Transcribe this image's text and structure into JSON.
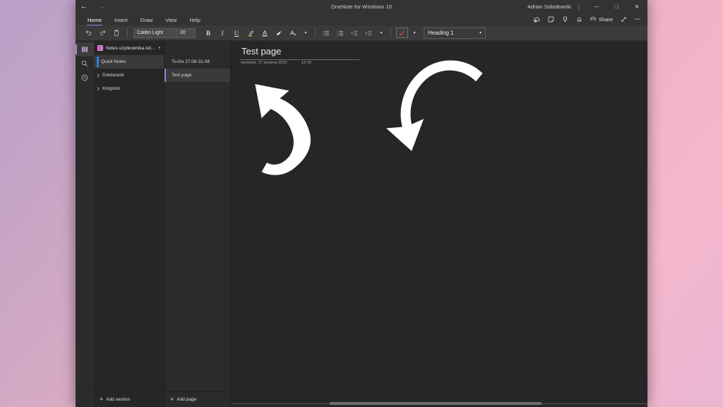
{
  "window": {
    "title": "OneNote for Windows 10",
    "account": "Adrian Sobolewski",
    "back_icon": "back-arrow-icon",
    "forward_icon": "forward-arrow-icon",
    "minimize": "─",
    "maximize": "□",
    "close": "✕",
    "separator": "|"
  },
  "ribbon": {
    "tabs": [
      {
        "label": "Home",
        "active": true
      },
      {
        "label": "Insert",
        "active": false
      },
      {
        "label": "Draw",
        "active": false
      },
      {
        "label": "View",
        "active": false
      },
      {
        "label": "Help",
        "active": false
      }
    ],
    "right_icons": [
      "sync-cloud-icon",
      "sticky-note-icon",
      "idea-lightbulb-icon",
      "notification-bell-icon"
    ],
    "share_label": "Share",
    "share_icon": "share-icon",
    "expand_icon": "expand-diagonal-icon",
    "more_icon": "more-options-icon"
  },
  "toolbar": {
    "undo_icon": "undo-icon",
    "redo_icon": "redo-icon",
    "clipboard_icon": "clipboard-paste-icon",
    "font_name": "Calibri Light",
    "font_size": "20",
    "bold_label": "B",
    "italic_label": "I",
    "underline_label": "U",
    "highlight_icon": "highlighter-icon",
    "font_color_icon": "font-color-icon",
    "format_painter_icon": "format-painter-icon",
    "clear_format_icon": "clear-formatting-icon",
    "more_format_icon": "chevron-down-icon",
    "bullets_icon": "bullet-list-icon",
    "numbering_icon": "numbered-list-icon",
    "decrease_indent_icon": "decrease-indent-icon",
    "increase_indent_icon": "increase-indent-icon",
    "indent_more_icon": "chevron-down-icon",
    "todo_tag_icon": "todo-checkbox-icon",
    "tag_more_icon": "chevron-down-icon",
    "style_value": "Heading 1",
    "style_chevron": "chevron-down-icon",
    "highlight_color": "#d9b441",
    "accent_color": "#a97fd4"
  },
  "rail": {
    "items": [
      {
        "name": "notebooks-icon",
        "active": true
      },
      {
        "name": "search-icon",
        "active": false
      },
      {
        "name": "recent-clock-icon",
        "active": false
      }
    ]
  },
  "notebook": {
    "name": "Notes użytkownika Adrian",
    "swatch_color": "#cc66cc",
    "chevron": "⌄",
    "sort_icon": "sort-sections-icon",
    "sections": [
      {
        "label": "Quick Notes",
        "active": true,
        "expandable": false,
        "arrow": ""
      },
      {
        "label": "Doktoracik",
        "active": false,
        "expandable": true,
        "arrow": "❯"
      },
      {
        "label": "Kingston",
        "active": false,
        "expandable": true,
        "arrow": "❯"
      }
    ],
    "add_section_label": "Add section",
    "add_section_icon": "plus-icon"
  },
  "pages": {
    "items": [
      {
        "label": "To-Do 27.08-31.08",
        "active": false
      },
      {
        "label": "Test page",
        "active": true
      }
    ],
    "add_page_label": "Add page",
    "add_page_icon": "plus-icon"
  },
  "canvas": {
    "page_title": "Test page",
    "date": "niedziela, 27 sierpnia 2023",
    "time": "14:18",
    "annotations": [
      {
        "name": "curved-arrow-up-left",
        "target": "page-title"
      },
      {
        "name": "curved-arrow-down-left",
        "target": "canvas-body"
      }
    ]
  }
}
